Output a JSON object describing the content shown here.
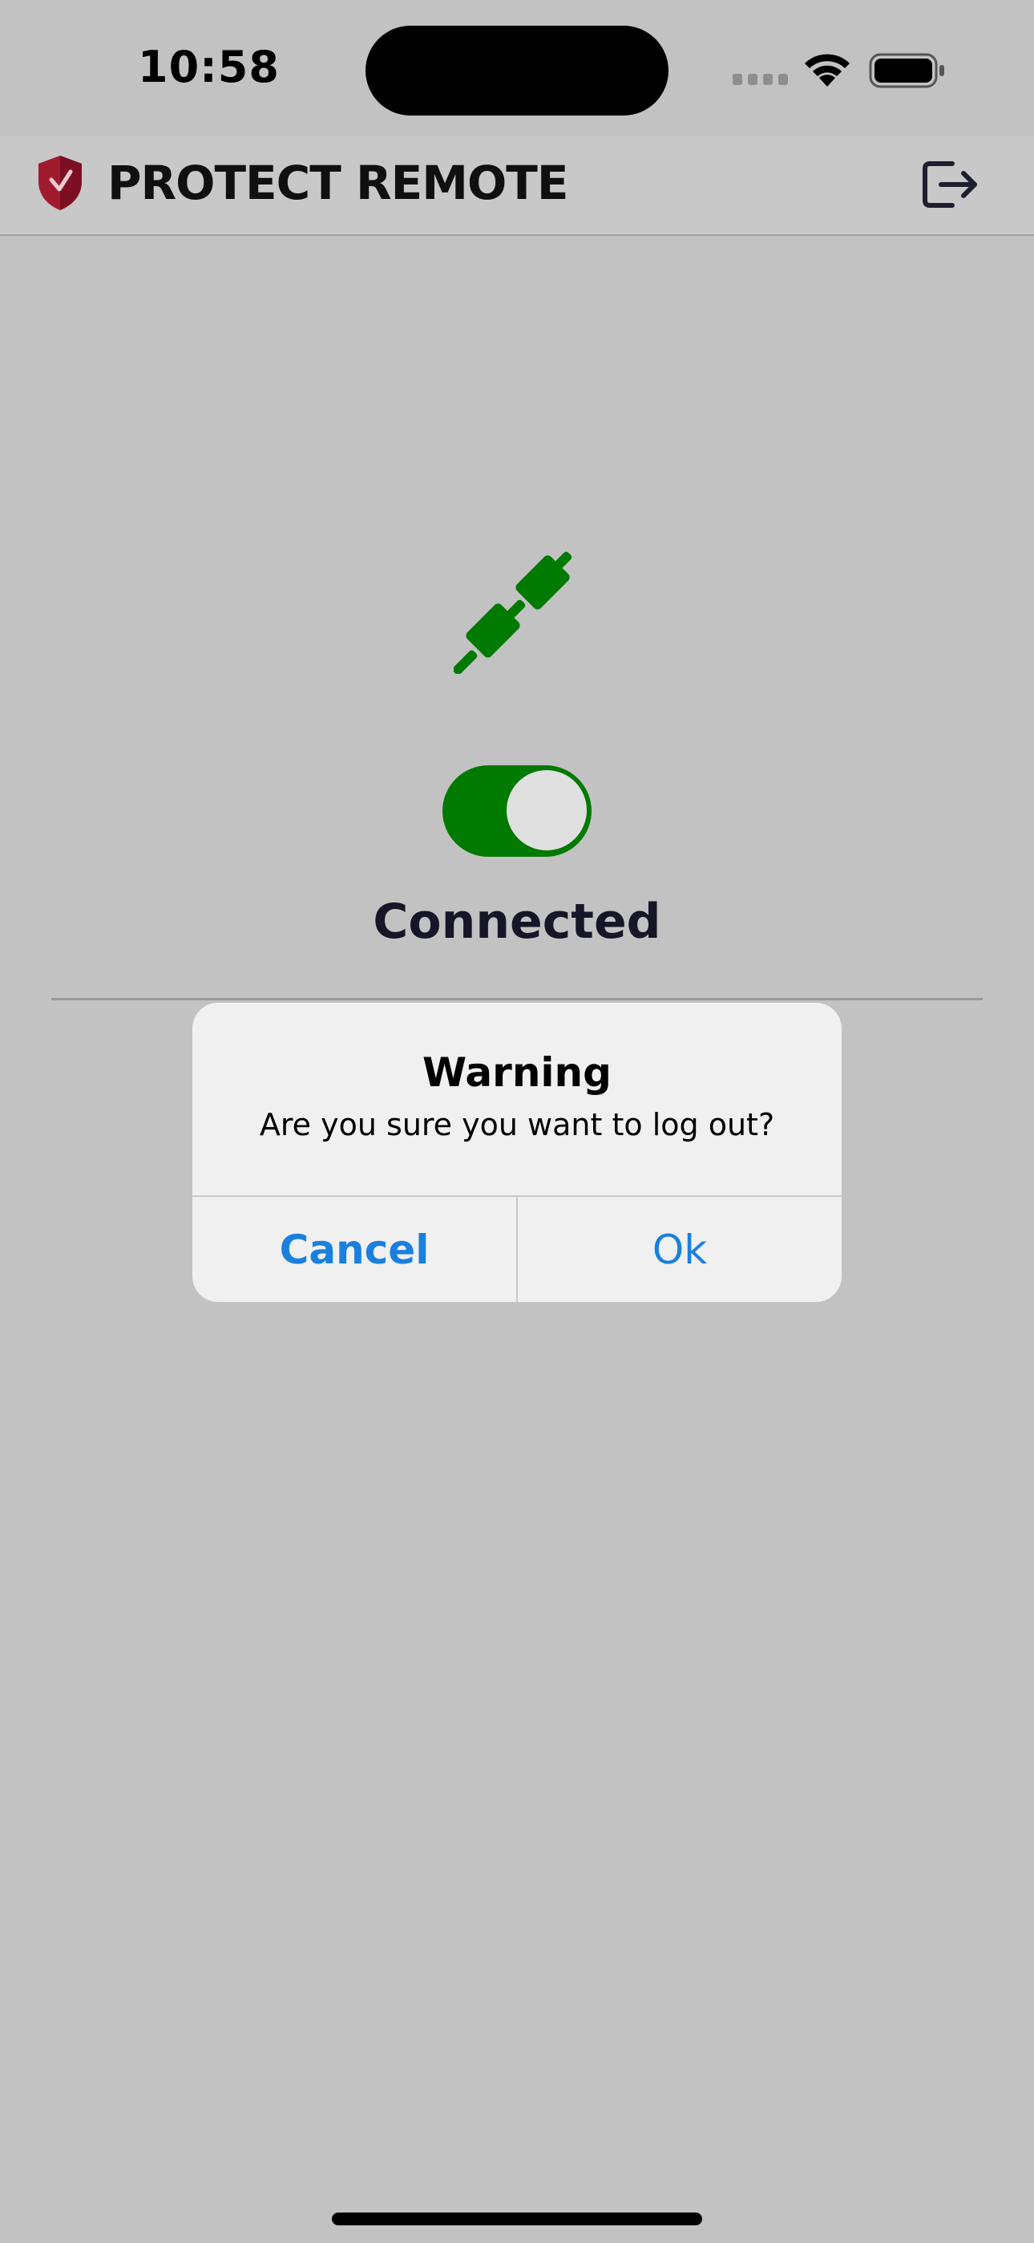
{
  "status_bar": {
    "time": "10:58",
    "icons": [
      "signal-icon",
      "wifi-icon",
      "battery-icon"
    ]
  },
  "header": {
    "title": "PROTECT REMOTE",
    "logo_icon": "shield-icon",
    "logout_icon": "logout-icon"
  },
  "main": {
    "connection_icon": "plug-icon",
    "toggle_on": true,
    "status_label": "Connected"
  },
  "alert": {
    "title": "Warning",
    "message": "Are you sure you want to log out?",
    "cancel_label": "Cancel",
    "ok_label": "Ok"
  },
  "colors": {
    "accent_green": "#007a00",
    "link_blue": "#1b7fdd",
    "shield_red": "#a01a2e",
    "overlay_gray": "#c2c2c2"
  }
}
